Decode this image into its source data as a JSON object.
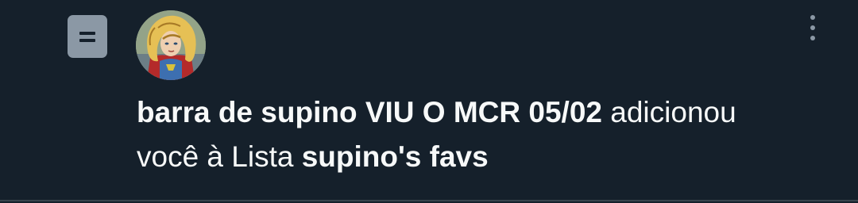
{
  "notification": {
    "icon": "list-icon",
    "avatar_icon": "user-avatar",
    "more_icon": "more-vertical-icon",
    "user_name": "barra de supino VIU O MCR 05/02",
    "action_text_1": " adicionou",
    "action_text_2": "você à Lista ",
    "list_name": "supino's favs"
  },
  "colors": {
    "background": "#15202b",
    "text": "#f7f9f9",
    "secondary": "#8b98a5",
    "divider": "#38444d"
  }
}
